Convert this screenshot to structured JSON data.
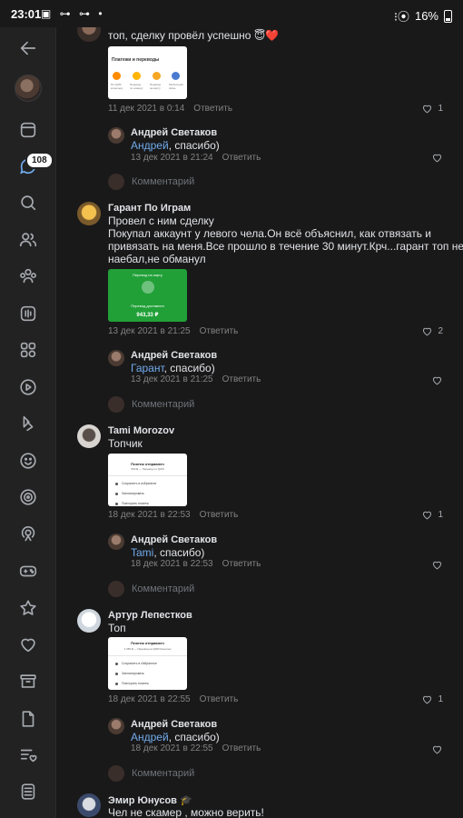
{
  "status_bar": {
    "time": "23:01",
    "left_icons": "▣ ⊶ ⊶ •",
    "signal": "⁝⦿",
    "battery": "16%"
  },
  "sidebar": {
    "messages_badge": "108"
  },
  "top_comment": {
    "text": "топ, сделку провёл успешно 😇❤️",
    "thumb": {
      "header": "Платежи и переводы",
      "labels": [
        "По QIWI кошельку",
        "Перевод по номеру",
        "Перевод на карту",
        "Мобильная связь"
      ]
    },
    "date": "11 дек 2021 в 0:14",
    "reply_label": "Ответить",
    "likes": "1"
  },
  "threads": [
    {
      "author": "Гарант По Играм",
      "text_lines": [
        "Провел с ним сделку",
        "Покупал аккаунт у левого чела.Он всё объяснил, как отвязать и",
        "привязать на меня.Все прошло в течение 30 минут.Крч...гарант топ не",
        "наебал,не обманул"
      ],
      "thumb": {
        "top_text": "Перевод на карту",
        "caption": "Перевод доставлен",
        "amount": "943,33 ₽"
      },
      "date": "13 дек 2021 в 21:25",
      "reply_label": "Ответить",
      "likes": "2",
      "reply": {
        "author": "Андрей Светаков",
        "mention": "Гарант",
        "rest": ", спасибо)",
        "date": "13 дек 2021 в 21:25",
        "reply_label": "Ответить"
      }
    },
    {
      "author": "Tami Morozov",
      "text_lines": [
        "Топчик"
      ],
      "thumb": {
        "title": "Платеж отправлен",
        "subtitle": "500 ₽ — Перевод по QIWI",
        "rows": [
          "Сохранить в избранное",
          "Запланировать",
          "Повторить платеж"
        ]
      },
      "date": "18 дек 2021 в 22:53",
      "reply_label": "Ответить",
      "likes": "1",
      "reply": {
        "author": "Андрей Светаков",
        "mention": "Tami",
        "rest": ", спасибо)",
        "date": "18 дек 2021 в 22:53",
        "reply_label": "Ответить"
      }
    },
    {
      "author": "Артур Лепестков",
      "text_lines": [
        "Топ"
      ],
      "thumb": {
        "title": "Платеж отправлен",
        "subtitle": "1 050 ₽ — Перевод на QIWI Кошелек",
        "rows": [
          "Сохранить в Избранное",
          "Запланировать",
          "Повторить платеж"
        ]
      },
      "date": "18 дек 2021 в 22:55",
      "reply_label": "Ответить",
      "likes": "1",
      "reply": {
        "author": "Андрей Светаков",
        "mention": "Андрей",
        "rest": ", спасибо)",
        "date": "18 дек 2021 в 22:55",
        "reply_label": "Ответить"
      }
    }
  ],
  "first_reply": {
    "author": "Андрей Светаков",
    "mention": "Андрей",
    "rest": ", спасибо)",
    "date": "13 дек 2021 в 21:24",
    "reply_label": "Ответить"
  },
  "comment_placeholder": "Комментарий",
  "last_comment": {
    "author": "Эмир Юнусов",
    "author_badge": "🎓",
    "text": "Чел не скамер , можно верить!"
  }
}
